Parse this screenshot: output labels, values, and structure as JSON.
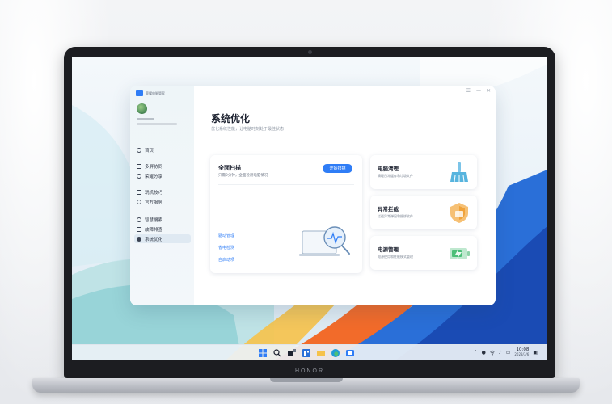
{
  "device": {
    "brand": "HONOR"
  },
  "app": {
    "name": "荣耀电脑管家",
    "window_controls": [
      "☰",
      "—",
      "✕"
    ],
    "sidebar": {
      "items": [
        {
          "label": "首页",
          "icon": "home-icon"
        },
        {
          "label": "多屏协同",
          "icon": "multiscreen-icon"
        },
        {
          "label": "荣耀分享",
          "icon": "share-icon"
        },
        {
          "label": "玩机技巧",
          "icon": "tips-icon"
        },
        {
          "label": "官方服务",
          "icon": "service-icon"
        },
        {
          "label": "智慧搜索",
          "icon": "smart-search-icon"
        },
        {
          "label": "故障排查",
          "icon": "troubleshoot-icon"
        },
        {
          "label": "系统优化",
          "icon": "optimize-icon",
          "active": true
        }
      ]
    },
    "main": {
      "title": "系统优化",
      "subtitle": "优化系统性能，让电脑时刻处于最佳状态",
      "full_scan": {
        "title": "全面扫描",
        "desc": "只需2分钟，全面检测电脑情况",
        "button": "开始扫描",
        "links": [
          "驱动管理",
          "省电检测",
          "自启动项"
        ]
      },
      "tiles": [
        {
          "title": "电脑清理",
          "desc": "清理日常缓存和垃圾文件",
          "icon": "broom-icon",
          "accent": "#3aa7d8"
        },
        {
          "title": "异常拦截",
          "desc": "拦截异常弹窗和捆绑软件",
          "icon": "shield-block-icon",
          "accent": "#f0a23a"
        },
        {
          "title": "电源管理",
          "desc": "电源使用和性能模式管理",
          "icon": "battery-icon",
          "accent": "#4cbf78"
        }
      ]
    }
  },
  "taskbar": {
    "apps": [
      "windows-start-icon",
      "search-icon",
      "task-view-icon",
      "widgets-icon",
      "file-explorer-icon",
      "edge-browser-icon",
      "pc-manager-icon"
    ],
    "tray": [
      "^",
      "●",
      "令",
      "♪",
      "▭"
    ],
    "time": "10:08",
    "date": "2023/3/6"
  },
  "colors": {
    "accent": "#2f7df6",
    "bezel": "#1c1d21"
  }
}
